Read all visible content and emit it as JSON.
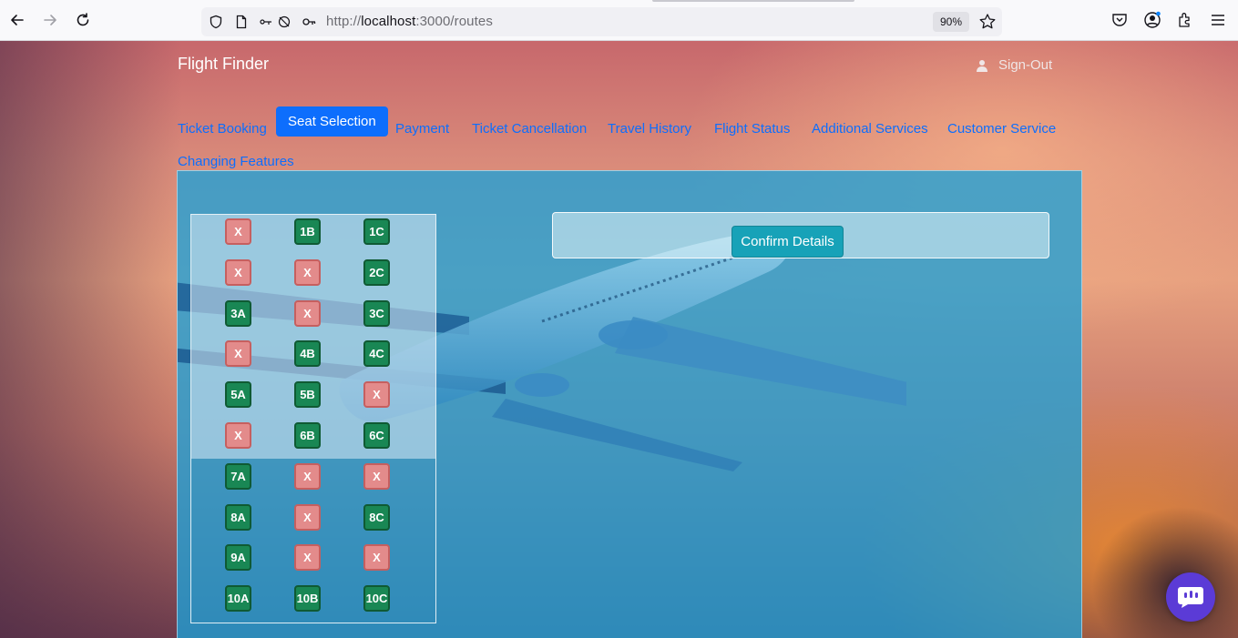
{
  "browser": {
    "url_prefix": "http://",
    "url_host": "localhost",
    "url_rest": ":3000/routes",
    "zoom": "90%"
  },
  "header": {
    "brand": "Flight Finder",
    "signout_label": "Sign-Out"
  },
  "tabs": [
    {
      "label": "Ticket Booking",
      "active": false
    },
    {
      "label": "Seat Selection",
      "active": true
    },
    {
      "label": "Payment",
      "active": false
    },
    {
      "label": "Ticket Cancellation",
      "active": false
    },
    {
      "label": "Travel History",
      "active": false
    },
    {
      "label": "Flight Status",
      "active": false
    },
    {
      "label": "Additional Services",
      "active": false
    },
    {
      "label": "Customer Service",
      "active": false
    },
    {
      "label": "Changing Features",
      "active": false
    }
  ],
  "seats": {
    "rows": [
      [
        "X",
        "1B",
        "1C"
      ],
      [
        "X",
        "X",
        "2C"
      ],
      [
        "3A",
        "X",
        "3C"
      ],
      [
        "X",
        "4B",
        "4C"
      ],
      [
        "5A",
        "5B",
        "X"
      ],
      [
        "X",
        "6B",
        "6C"
      ],
      [
        "7A",
        "X",
        "X"
      ],
      [
        "8A",
        "X",
        "8C"
      ],
      [
        "9A",
        "X",
        "X"
      ],
      [
        "10A",
        "10B",
        "10C"
      ]
    ],
    "available_color": "#198754",
    "booked_color": "#e38b8b"
  },
  "confirm": {
    "button_label": "Confirm Details"
  },
  "colors": {
    "primary": "#0d6efd",
    "info": "#17a2b8",
    "chat": "#5b3bd6"
  }
}
